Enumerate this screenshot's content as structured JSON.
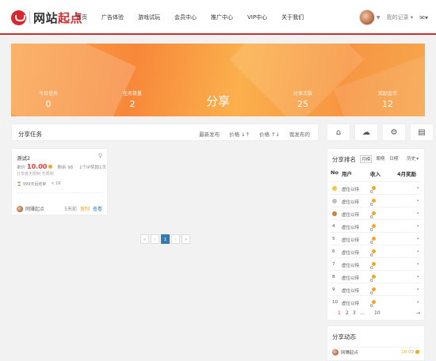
{
  "brand": {
    "prefix": "网站",
    "highlight": "起点"
  },
  "nav": [
    "首页",
    "广告体验",
    "游戏试玩",
    "会员中心",
    "推广中心",
    "VIP中心",
    "关于我们"
  ],
  "header_right": {
    "records": "我的记录"
  },
  "banner": {
    "title": "分享",
    "stats": [
      {
        "label": "今日任务",
        "value": "0"
      },
      {
        "label": "任务数量",
        "value": "2"
      },
      {
        "label": "分享次数",
        "value": "25"
      },
      {
        "label": "奖励金币",
        "value": "12"
      }
    ]
  },
  "task_bar": {
    "title": "分享任务",
    "sorts": [
      "最新发布",
      "价格 ↓↑",
      "价格 ↑↓",
      "我发布的"
    ]
  },
  "card": {
    "name": "测试2",
    "unit_label": "单价",
    "price": "10.00",
    "pay_label": "剩余 98",
    "reward_note": "1个IP奖励1次",
    "limit": "分享者无限制 无限制",
    "expire": "⌛ 999天后结束",
    "shares": "< 16",
    "user": "网赚起点",
    "days_left": "5天前",
    "copy": "复制",
    "view": "查看"
  },
  "pager": [
    "«",
    "‹",
    "1",
    "›",
    "»"
  ],
  "rank": {
    "title": "分享排名",
    "tabs": [
      "月榜",
      "周榜",
      "日榜",
      "历史"
    ],
    "cols": {
      "no": "No",
      "user": "用户",
      "income": "收入",
      "award": "4月奖励"
    },
    "rows": [
      {
        "no": "",
        "user": "虚位以待",
        "income": "0"
      },
      {
        "no": "",
        "user": "虚位以待",
        "income": "0"
      },
      {
        "no": "",
        "user": "虚位以待",
        "income": "0"
      },
      {
        "no": "4",
        "user": "虚位以待",
        "income": "0"
      },
      {
        "no": "5",
        "user": "虚位以待",
        "income": "0"
      },
      {
        "no": "6",
        "user": "虚位以待",
        "income": "0"
      },
      {
        "no": "7",
        "user": "虚位以待",
        "income": "0"
      },
      {
        "no": "8",
        "user": "虚位以待",
        "income": "0"
      },
      {
        "no": "9",
        "user": "虚位以待",
        "income": "0"
      },
      {
        "no": "10",
        "user": "虚位以待",
        "income": "0"
      }
    ],
    "pages": [
      "1",
      "2",
      "3",
      "...",
      "10",
      "→"
    ]
  },
  "share_feed": {
    "title": "分享动态",
    "user": "网赚起点",
    "value": "10.00"
  },
  "colors": {
    "accent": "#d9272e",
    "banner": "#f79642",
    "coin": "#f5a623",
    "price": "#e4393c",
    "link": "#337ab7"
  }
}
